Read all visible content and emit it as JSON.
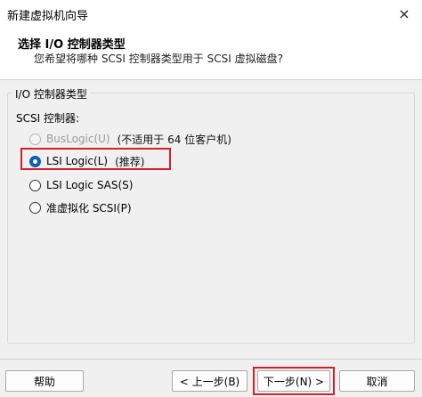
{
  "window": {
    "title": "新建虚拟机向导",
    "close_glyph": "×"
  },
  "header": {
    "title": "选择 I/O 控制器类型",
    "subtitle": "您希望将哪种 SCSI 控制器类型用于 SCSI 虚拟磁盘?"
  },
  "group": {
    "legend": "I/O 控制器类型",
    "scsi_label": "SCSI 控制器:",
    "options": [
      {
        "label": "BusLogic(U)",
        "note": "(不适用于 64 位客户机)",
        "state": "disabled"
      },
      {
        "label": "LSI Logic(L)",
        "note": "(推荐)",
        "state": "checked"
      },
      {
        "label": "LSI Logic SAS(S)",
        "note": "",
        "state": "unchecked"
      },
      {
        "label": "准虚拟化 SCSI(P)",
        "note": "",
        "state": "unchecked"
      }
    ]
  },
  "buttons": {
    "help": "帮助",
    "back": "< 上一步(B)",
    "next": "下一步(N) >",
    "cancel": "取消"
  },
  "colors": {
    "highlight": "#d0212b",
    "radio_selected": "#0b5fb4"
  }
}
